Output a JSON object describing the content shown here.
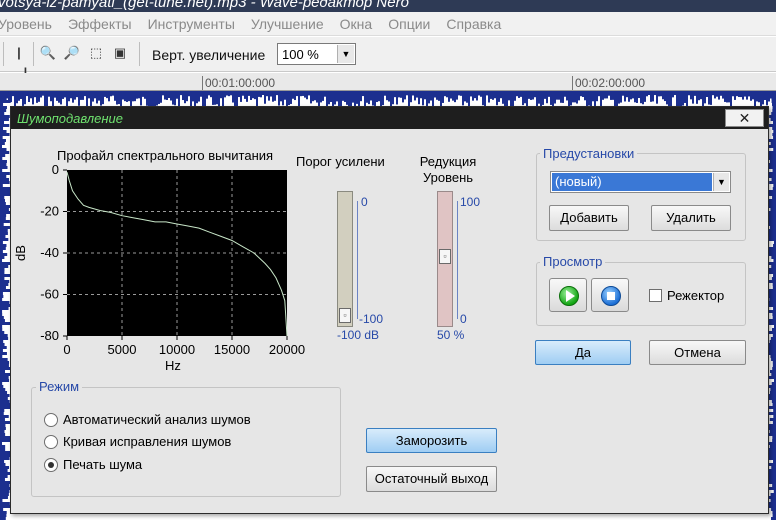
{
  "app": {
    "window_title": "votsya-iz-pamyati_(get-tune.net).mp3 - Wave-редактор Nero",
    "menu": [
      "Уровень",
      "Эффекты",
      "Инструменты",
      "Улучшение",
      "Окна",
      "Опции",
      "Справка"
    ],
    "toolbar": {
      "vertical_zoom_label": "Верт. увеличение",
      "vertical_zoom_value": "100 %"
    },
    "timeline": [
      "00:01:00:000",
      "00:02:00:000"
    ]
  },
  "dialog": {
    "title": "Шумоподавление",
    "close_label": "✕",
    "profile": {
      "title": "Профайл спектрального вычитания"
    },
    "gain": {
      "title": "Порог усилени",
      "scale_top": "0",
      "scale_bottom": "-100",
      "value_label": "-100 dB",
      "value": -100
    },
    "reduction": {
      "title_line1": "Редукция",
      "title_line2": "Уровень",
      "scale_top": "100",
      "scale_bottom": "0",
      "value_label": "50 %",
      "value": 50
    },
    "presets": {
      "group_label": "Предустановки",
      "selected": "(новый)",
      "add_label": "Добавить",
      "delete_label": "Удалить"
    },
    "preview": {
      "group_label": "Просмотр",
      "bypass_label": "Режектор",
      "bypass_checked": false
    },
    "ok_label": "Да",
    "cancel_label": "Отмена",
    "mode": {
      "group_label": "Режим",
      "options": [
        "Автоматический анализ шумов",
        "Кривая исправления шумов",
        "Печать шума"
      ],
      "selected_index": 2
    },
    "freeze_label": "Заморозить",
    "residual_label": "Остаточный выход"
  },
  "colors": {
    "dialog_title_text": "#6fe26f",
    "curve": "#c8e6c8",
    "accent_blue": "#2749a8"
  },
  "chart_data": {
    "type": "line",
    "title": "Профайл спектрального вычитания",
    "xlabel": "Hz",
    "ylabel": "dB",
    "xlim": [
      0,
      20000
    ],
    "ylim": [
      -80,
      0
    ],
    "x_ticks": [
      0,
      5000,
      10000,
      15000,
      20000
    ],
    "y_ticks": [
      0,
      -20,
      -40,
      -60,
      -80
    ],
    "grid": true,
    "series": [
      {
        "x": [
          0,
          200,
          500,
          1000,
          1500,
          2000,
          3000,
          4000,
          5000,
          6000,
          7000,
          8000,
          9000,
          10000,
          11000,
          12000,
          13000,
          14000,
          15000,
          16000,
          17000,
          18000,
          18500,
          19000,
          19500,
          19800,
          20000
        ],
        "y": [
          -1,
          -5,
          -10,
          -14,
          -17,
          -18,
          -19.5,
          -20.5,
          -22,
          -23,
          -24,
          -25,
          -25,
          -26,
          -27,
          -28,
          -30,
          -32,
          -34,
          -37,
          -40,
          -45,
          -48,
          -52,
          -58,
          -63,
          -80
        ]
      }
    ]
  }
}
